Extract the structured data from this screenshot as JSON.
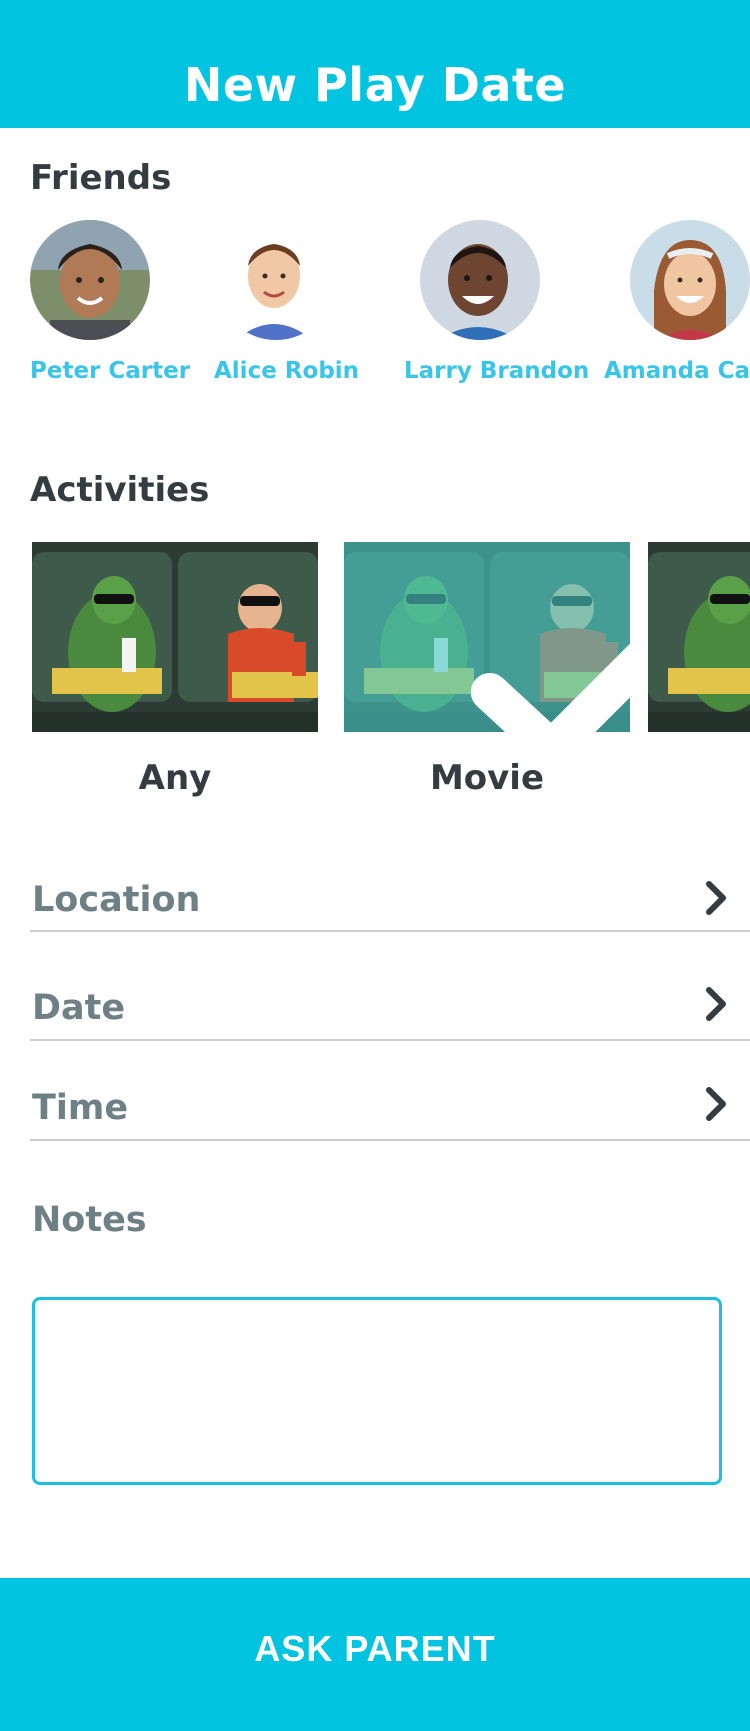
{
  "header": {
    "title": "New Play Date"
  },
  "friends": {
    "title": "Friends",
    "items": [
      {
        "name": "Peter Carter"
      },
      {
        "name": "Alice Robin"
      },
      {
        "name": "Larry Brandon"
      },
      {
        "name": "Amanda Carter"
      }
    ]
  },
  "activities": {
    "title": "Activities",
    "items": [
      {
        "label": "Any",
        "selected": false
      },
      {
        "label": "Movie",
        "selected": true
      },
      {
        "label": "",
        "selected": false
      }
    ]
  },
  "fields": {
    "location": "Location",
    "date": "Date",
    "time": "Time"
  },
  "notes": {
    "label": "Notes",
    "value": ""
  },
  "footer": {
    "button_label": "ASK PARENT"
  },
  "colors": {
    "accent": "#00c4e0",
    "friend_name": "#39c5e8",
    "selected_overlay": "#48c8c4",
    "field_label": "#6e8086"
  }
}
